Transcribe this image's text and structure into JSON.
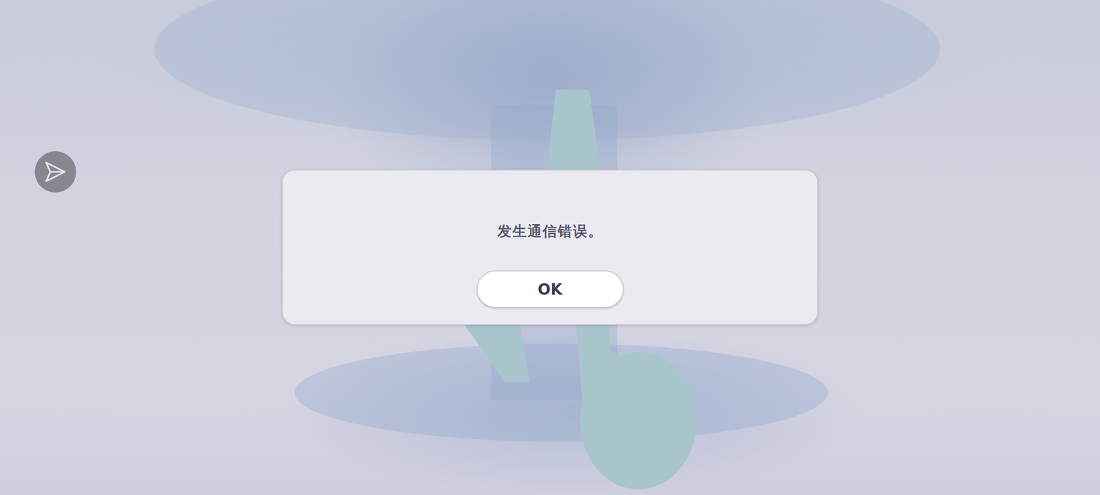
{
  "dialog": {
    "message": "发生通信错误。",
    "buttons": [
      "OK"
    ]
  }
}
